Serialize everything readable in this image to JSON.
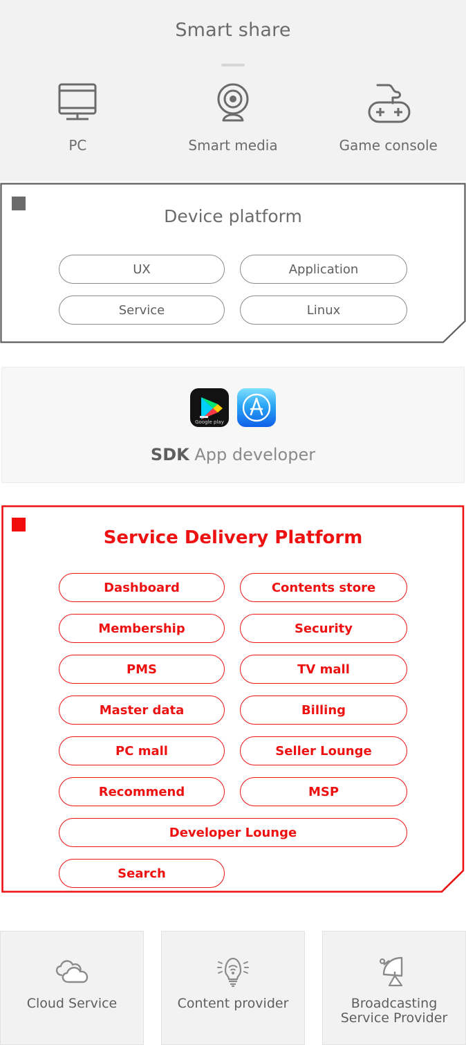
{
  "smart_share": {
    "title": "Smart share",
    "items": [
      {
        "label": "PC",
        "icon": "monitor-icon"
      },
      {
        "label": "Smart media",
        "icon": "webcam-icon"
      },
      {
        "label": "Game console",
        "icon": "gamepad-icon"
      }
    ]
  },
  "device_platform": {
    "title": "Device platform",
    "marker_color": "#6b6b6b",
    "pills": [
      {
        "label": "UX",
        "col": 0,
        "row": 0
      },
      {
        "label": "Application",
        "col": 1,
        "row": 0
      },
      {
        "label": "Service",
        "col": 0,
        "row": 1
      },
      {
        "label": "Linux",
        "col": 1,
        "row": 1
      }
    ]
  },
  "sdk": {
    "bold_label": "SDK",
    "label": "App developer",
    "icons": [
      {
        "name": "google-play-icon"
      },
      {
        "name": "app-store-icon"
      }
    ]
  },
  "service_delivery_platform": {
    "title": "Service Delivery Platform",
    "accent_color": "#ee1111",
    "marker_color": "#f20d0d",
    "pills": [
      {
        "label": "Dashboard",
        "col": 0,
        "row": 0,
        "wide": false
      },
      {
        "label": "Contents store",
        "col": 1,
        "row": 0,
        "wide": false
      },
      {
        "label": "Membership",
        "col": 0,
        "row": 1,
        "wide": false
      },
      {
        "label": "Security",
        "col": 1,
        "row": 1,
        "wide": false
      },
      {
        "label": "PMS",
        "col": 0,
        "row": 2,
        "wide": false
      },
      {
        "label": "TV mall",
        "col": 1,
        "row": 2,
        "wide": false
      },
      {
        "label": "Master data",
        "col": 0,
        "row": 3,
        "wide": false
      },
      {
        "label": "Billing",
        "col": 1,
        "row": 3,
        "wide": false
      },
      {
        "label": "PC mall",
        "col": 0,
        "row": 4,
        "wide": false
      },
      {
        "label": "Seller Lounge",
        "col": 1,
        "row": 4,
        "wide": false
      },
      {
        "label": "Recommend",
        "col": 0,
        "row": 5,
        "wide": false
      },
      {
        "label": "MSP",
        "col": 1,
        "row": 5,
        "wide": false
      },
      {
        "label": "Developer Lounge",
        "col": 0,
        "row": 6,
        "wide": true
      },
      {
        "label": "Search",
        "col": 0,
        "row": 7,
        "wide": false
      }
    ]
  },
  "providers": [
    {
      "label": "Cloud Service",
      "icon": "cloud-icon"
    },
    {
      "label": "Content provider",
      "icon": "lightbulb-wifi-icon"
    },
    {
      "label": "Broadcasting\nService Provider",
      "icon": "satellite-dish-icon"
    }
  ]
}
